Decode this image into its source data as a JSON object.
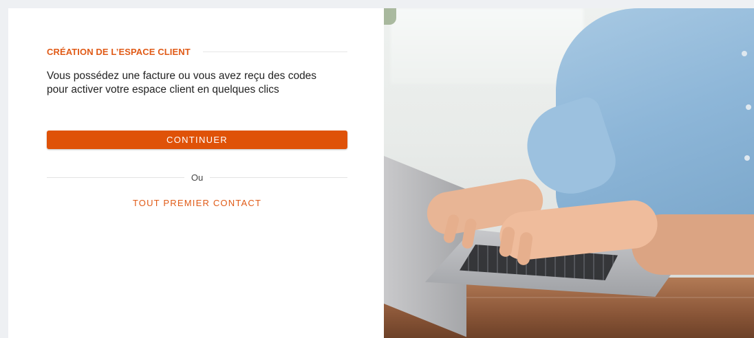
{
  "section": {
    "title": "CRÉATION DE L’ESPACE CLIENT",
    "intro": "Vous possédez une facture ou vous avez reçu des codes pour activer votre espace client en quelques clics"
  },
  "actions": {
    "continue_label": "CONTINUER",
    "divider_text": "Ou",
    "first_contact_label": "TOUT PREMIER CONTACT"
  },
  "colors": {
    "accent": "#df5208",
    "accent_text": "#e05a16"
  }
}
